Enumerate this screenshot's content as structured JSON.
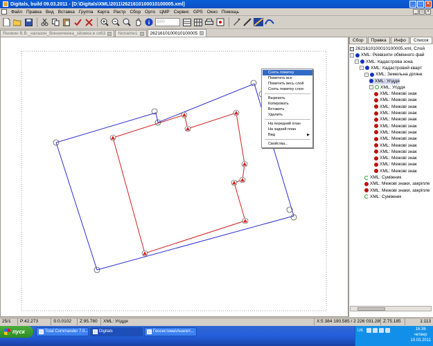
{
  "window": {
    "title": "Digitals, build 09.03.2011 - [D:\\Digitals\\XML\\2011\\2621610100010100005.xml]"
  },
  "menubar": {
    "items": [
      "Файл",
      "Правка",
      "Вид",
      "Вставка",
      "Группа",
      "Карта",
      "Растр",
      "Сбор",
      "Орто",
      "ЦМР",
      "Сервис",
      "GPS",
      "Окно",
      "Помощь"
    ]
  },
  "toolbar": {
    "zoom_value": "500",
    "icons": [
      "new-file-icon",
      "open-folder-icon",
      "save-icon",
      "cut-icon",
      "copy-icon",
      "paste-icon",
      "check-icon",
      "delete-icon",
      "zoom-in-icon",
      "zoom-out-icon",
      "zoom-extent-icon",
      "pan-hand-icon",
      "info-icon",
      "layers-icon",
      "table-icon",
      "print-icon",
      "snap-icon",
      "settings-icon",
      "tool-icon",
      "raster-icon",
      "curve-icon"
    ]
  },
  "doc_tabs": [
    {
      "label": "Яновин В.В._нагазин_Винниченка_зйомка в ск63",
      "active": false
    },
    {
      "label": "Noname1",
      "active": false
    },
    {
      "label": "2621610100010100005",
      "active": true
    }
  ],
  "context_menu": {
    "items": [
      {
        "label": "Снять пометку",
        "highlighted": true
      },
      {
        "label": "Пометить все"
      },
      {
        "label": "Пометить весь слой"
      },
      {
        "label": "Снять пометку слоя"
      },
      {
        "sep": true
      },
      {
        "label": "Вырезать"
      },
      {
        "label": "Копировать"
      },
      {
        "label": "Вставить"
      },
      {
        "label": "Удалить"
      },
      {
        "sep": true
      },
      {
        "label": "На передний план"
      },
      {
        "label": "На задний план"
      },
      {
        "label": "Вид",
        "submenu": true
      },
      {
        "sep": true
      },
      {
        "label": "Свойства..."
      }
    ]
  },
  "panel": {
    "tabs": [
      "Сбор",
      "Правка",
      "Инфо",
      "Список"
    ],
    "active_tab": "Список",
    "tree": [
      {
        "label": "2621610100010100005.xml, Слой",
        "icon": "file",
        "depth": 0
      },
      {
        "label": "XML: Реквізити обмінного фай",
        "icon": "blue",
        "depth": 0,
        "exp": "-"
      },
      {
        "label": "XML: Кадастрова зона",
        "icon": "blue",
        "depth": 1,
        "exp": "-"
      },
      {
        "label": "XML: Кадастровий кварт",
        "icon": "blue",
        "depth": 2,
        "exp": "-"
      },
      {
        "label": "XML: Земельна ділянк",
        "icon": "blue",
        "depth": 3,
        "exp": "-"
      },
      {
        "label": "XML: Угіддя",
        "icon": "blue",
        "depth": 4,
        "selected": true
      },
      {
        "label": "XML: Угіддя",
        "icon": "green",
        "depth": 4,
        "exp": "-"
      },
      {
        "label": "XML: Межові знак",
        "icon": "red",
        "depth": 5
      },
      {
        "label": "XML: Межові знак",
        "icon": "red",
        "depth": 5
      },
      {
        "label": "XML: Межові знак",
        "icon": "red",
        "depth": 5
      },
      {
        "label": "XML: Межові знак",
        "icon": "red",
        "depth": 5
      },
      {
        "label": "XML: Межові знак",
        "icon": "red",
        "depth": 5
      },
      {
        "label": "XML: Межові знак",
        "icon": "red",
        "depth": 5
      },
      {
        "label": "XML: Межові знак",
        "icon": "red",
        "depth": 5
      },
      {
        "label": "XML: Межові знак",
        "icon": "red",
        "depth": 5
      },
      {
        "label": "XML: Межові знак",
        "icon": "red",
        "depth": 5
      },
      {
        "label": "XML: Межові знак",
        "icon": "red",
        "depth": 5
      },
      {
        "label": "XML: Межові знак",
        "icon": "red",
        "depth": 5
      },
      {
        "label": "XML: Межові знак",
        "icon": "red",
        "depth": 5
      },
      {
        "label": "XML: Межові знак",
        "icon": "red",
        "depth": 5
      },
      {
        "label": "XML: Суміжник",
        "icon": "green-arc",
        "depth": 3
      },
      {
        "label": "XML: Межові знаки, закріпле",
        "icon": "red",
        "depth": 3
      },
      {
        "label": "XML: Межові знаки, закріпле",
        "icon": "red",
        "depth": 3
      },
      {
        "label": "XML: Суміжник",
        "icon": "green-arc",
        "depth": 3
      }
    ]
  },
  "statusbar": {
    "scale": "25/1",
    "p": "P:42.273",
    "s": "S:0.0102",
    "z": "Z:95.780",
    "layer": "XML: Угіддя",
    "coords": "X:5 384 190.585 / 2 226 031.285",
    "z2": "Z:75.185",
    "zoom": "1:113"
  },
  "taskbar": {
    "start_label": "пуск",
    "tasks": [
      {
        "label": "Total Commander 7.0...",
        "active": false
      },
      {
        "label": "Digitals",
        "active": true
      },
      {
        "label": "Геосистема\\Аналит...",
        "active": false
      }
    ],
    "lang": "UK",
    "time": "16:36",
    "day": "четвер",
    "date": "10.03.2011"
  },
  "colors": {
    "parcel_outline": "#2b2bd0",
    "land_use_outline": "#d01c1c",
    "marker_red": "#e02020",
    "selection_blue": "#316ac5"
  }
}
